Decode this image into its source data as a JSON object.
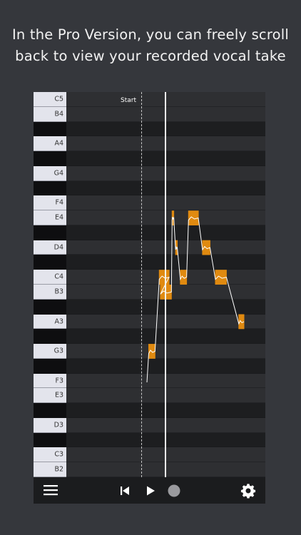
{
  "caption": {
    "line1": "In the Pro Version, you can freely scroll",
    "line2": "back to view your recorded vocal take"
  },
  "piano": {
    "keys": [
      {
        "label": "C5",
        "color": "white"
      },
      {
        "label": "B4",
        "color": "white"
      },
      {
        "label": "",
        "color": "black"
      },
      {
        "label": "A4",
        "color": "white"
      },
      {
        "label": "",
        "color": "black"
      },
      {
        "label": "G4",
        "color": "white"
      },
      {
        "label": "",
        "color": "black"
      },
      {
        "label": "F4",
        "color": "white"
      },
      {
        "label": "E4",
        "color": "white"
      },
      {
        "label": "",
        "color": "black"
      },
      {
        "label": "D4",
        "color": "white"
      },
      {
        "label": "",
        "color": "black"
      },
      {
        "label": "C4",
        "color": "white"
      },
      {
        "label": "B3",
        "color": "white"
      },
      {
        "label": "",
        "color": "black"
      },
      {
        "label": "A3",
        "color": "white"
      },
      {
        "label": "",
        "color": "black"
      },
      {
        "label": "G3",
        "color": "white"
      },
      {
        "label": "",
        "color": "black"
      },
      {
        "label": "F3",
        "color": "white"
      },
      {
        "label": "E3",
        "color": "white"
      },
      {
        "label": "",
        "color": "black"
      },
      {
        "label": "D3",
        "color": "white"
      },
      {
        "label": "",
        "color": "black"
      },
      {
        "label": "C3",
        "color": "white"
      },
      {
        "label": "B2",
        "color": "white"
      }
    ]
  },
  "roll": {
    "start_label": "Start"
  },
  "recorded_notes": [
    {
      "pitch": "G3",
      "start": 0.0,
      "length": 0.06
    },
    {
      "pitch": "B3",
      "start": 0.1,
      "length": 0.1
    },
    {
      "pitch": "C4",
      "start": 0.09,
      "length": 0.09
    },
    {
      "pitch": "E4",
      "start": 0.2,
      "length": 0.02
    },
    {
      "pitch": "D4",
      "start": 0.23,
      "length": 0.02
    },
    {
      "pitch": "C4",
      "start": 0.27,
      "length": 0.06
    },
    {
      "pitch": "E4",
      "start": 0.34,
      "length": 0.09
    },
    {
      "pitch": "D4",
      "start": 0.46,
      "length": 0.07
    },
    {
      "pitch": "C4",
      "start": 0.57,
      "length": 0.1
    },
    {
      "pitch": "A3",
      "start": 0.77,
      "length": 0.05
    }
  ],
  "toolbar": {
    "menu_icon": "hamburger-menu-icon",
    "rewind_icon": "skip-to-start-icon",
    "play_icon": "play-icon",
    "record_icon": "record-icon",
    "settings_icon": "gear-icon"
  },
  "colors": {
    "note_fill": "#e08a10",
    "pitch_trace": "#ffffff",
    "background": "#35373c"
  }
}
